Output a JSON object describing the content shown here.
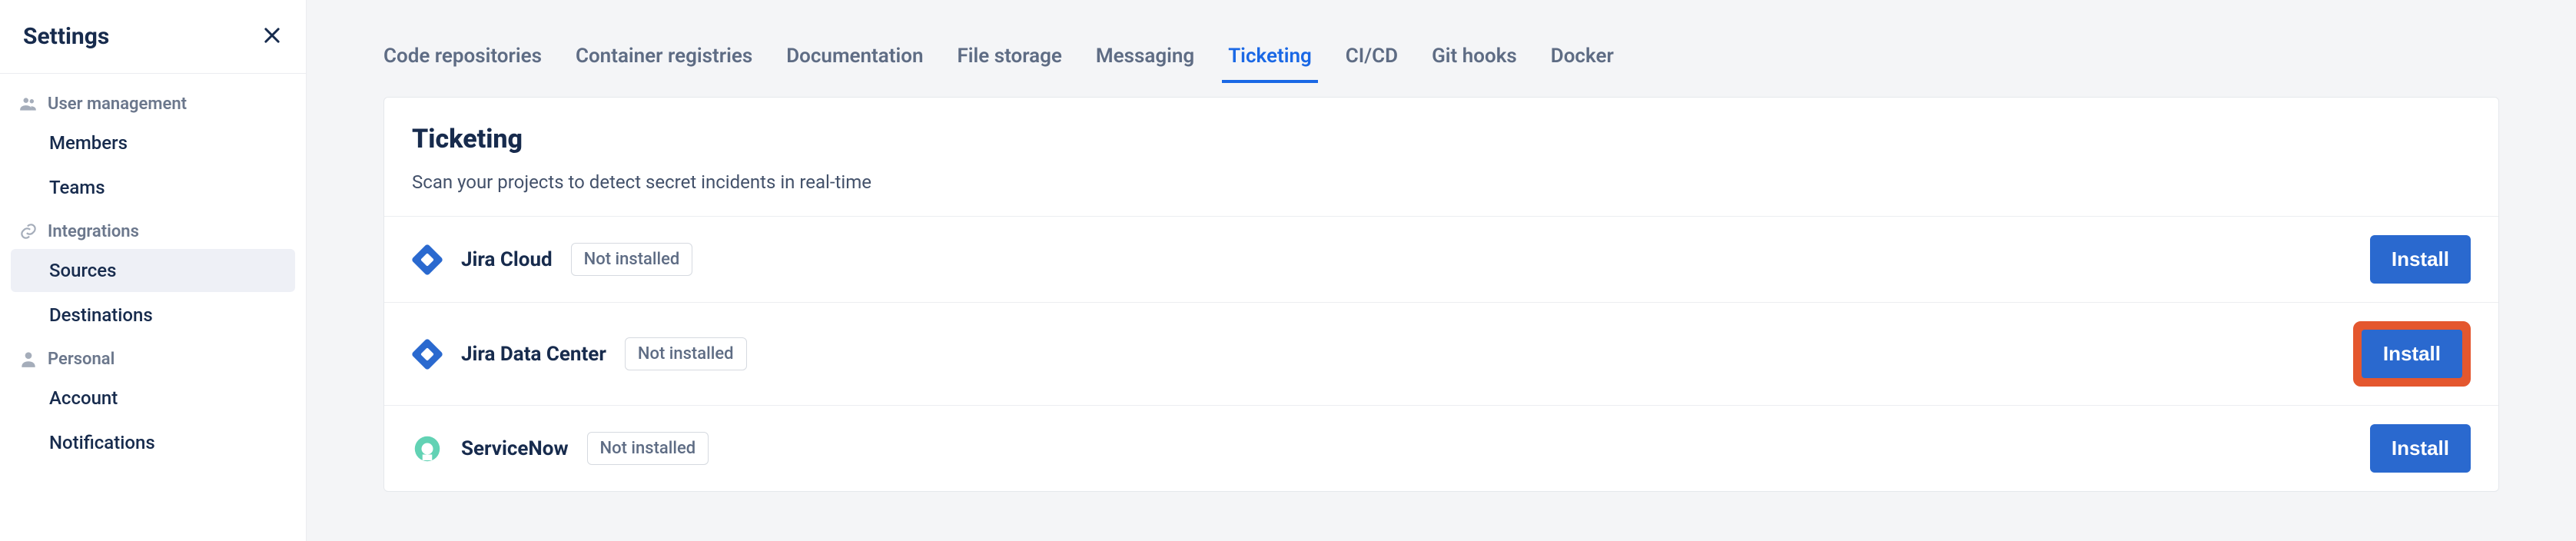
{
  "sidebar": {
    "title": "Settings",
    "sections": [
      {
        "label": "User management",
        "items": [
          {
            "label": "Members"
          },
          {
            "label": "Teams"
          }
        ]
      },
      {
        "label": "Integrations",
        "items": [
          {
            "label": "Sources",
            "selected": true
          },
          {
            "label": "Destinations"
          }
        ]
      },
      {
        "label": "Personal",
        "items": [
          {
            "label": "Account"
          },
          {
            "label": "Notifications"
          }
        ]
      }
    ]
  },
  "tabs": [
    {
      "label": "Code repositories"
    },
    {
      "label": "Container registries"
    },
    {
      "label": "Documentation"
    },
    {
      "label": "File storage"
    },
    {
      "label": "Messaging"
    },
    {
      "label": "Ticketing",
      "active": true
    },
    {
      "label": "CI/CD"
    },
    {
      "label": "Git hooks"
    },
    {
      "label": "Docker"
    }
  ],
  "panel": {
    "title": "Ticketing",
    "subtitle": "Scan your projects to detect secret incidents in real-time",
    "integrations": [
      {
        "name": "Jira Cloud",
        "status": "Not installed",
        "button": "Install",
        "icon": "jira",
        "highlighted": false
      },
      {
        "name": "Jira Data Center",
        "status": "Not installed",
        "button": "Install",
        "icon": "jira",
        "highlighted": true
      },
      {
        "name": "ServiceNow",
        "status": "Not installed",
        "button": "Install",
        "icon": "servicenow",
        "highlighted": false
      }
    ]
  }
}
